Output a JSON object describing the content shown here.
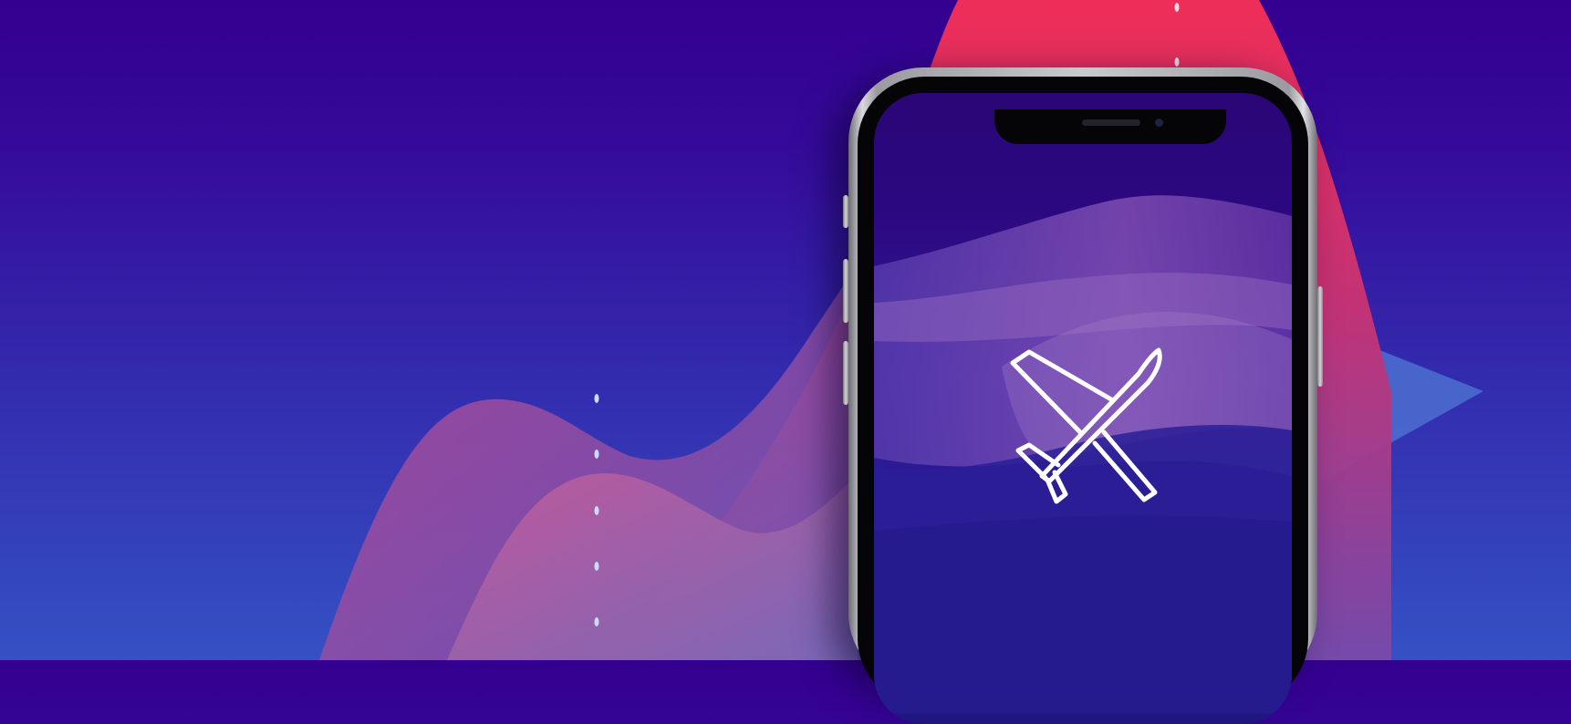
{
  "scene": {
    "accent_colors": {
      "background_top": "#340090",
      "background_bottom": "#3551c4",
      "wave_pink": "#e5305a",
      "wave_violet": "#a74a9a",
      "triangle_blue": "#4a6ccf"
    },
    "icons": [
      "airplane-icon"
    ]
  }
}
